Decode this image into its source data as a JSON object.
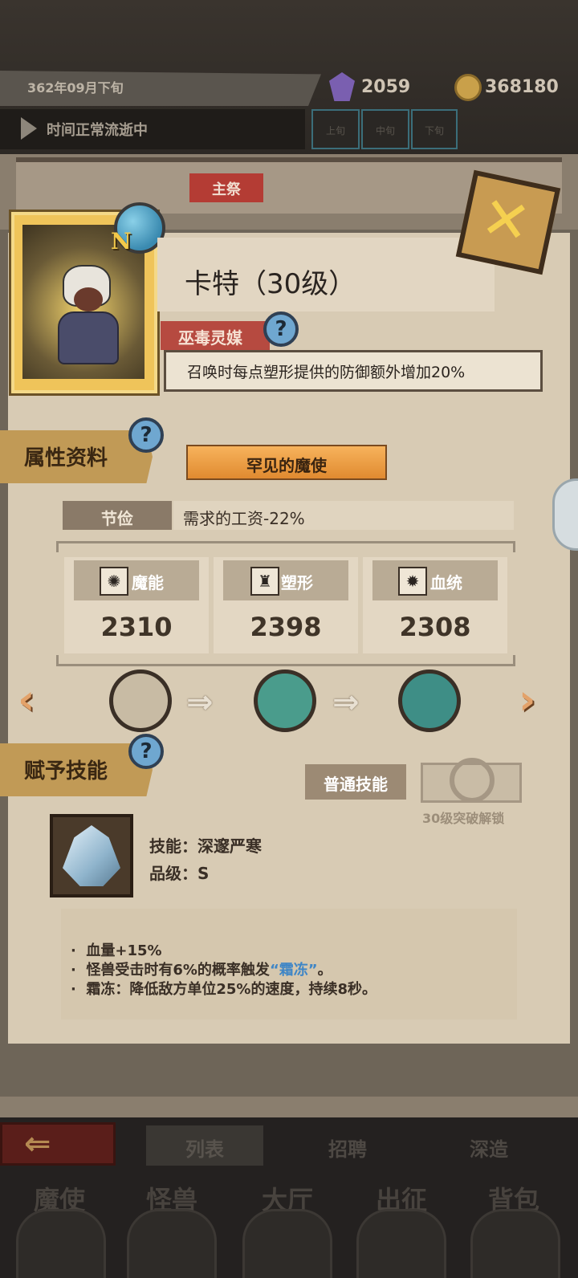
{
  "header": {
    "date": "362年09月下旬",
    "gems": "2059",
    "coins": "368180",
    "time_status": "时间正常流逝中",
    "speed_options": [
      "上旬",
      "中旬",
      "下旬"
    ]
  },
  "main_tag": "主祭",
  "hero": {
    "name": "卡特（30级）",
    "rarity": "N",
    "class_name": "巫毒灵媒",
    "trait": "召唤时每点塑形提供的防御额外增加20%"
  },
  "attributes": {
    "section_title": "属性资料",
    "rank_title": "罕见的魔使",
    "thrift_label": "节俭",
    "thrift_value": "需求的工资-22%",
    "stats": [
      {
        "name": "魔能",
        "value": "2310",
        "icon": "magic-icon"
      },
      {
        "name": "塑形",
        "value": "2398",
        "icon": "armor-icon"
      },
      {
        "name": "血统",
        "value": "2308",
        "icon": "bloodline-icon"
      }
    ]
  },
  "skills": {
    "section_title": "赋予技能",
    "normal_skill_button": "普通技能",
    "locked_hint": "30级突破解锁",
    "skill_name_line": "技能：深邃严寒",
    "grade_line": "品级：S",
    "desc": {
      "line1": "血量+15%",
      "line2_pre": "怪兽受击时有6%的概率触发",
      "line2_frost": "“霜冻”",
      "line2_post": "。",
      "line3": "霜冻：降低敌方单位25%的速度，持续8秒。"
    }
  },
  "bottom": {
    "tabs": [
      "列表",
      "招聘",
      "深造"
    ],
    "nav": [
      "魔使",
      "怪兽",
      "大厅",
      "出征",
      "背包"
    ]
  },
  "colors": {
    "accent_red": "#b43c34",
    "frost_blue": "#3f86c6",
    "gold": "#efc45a"
  }
}
